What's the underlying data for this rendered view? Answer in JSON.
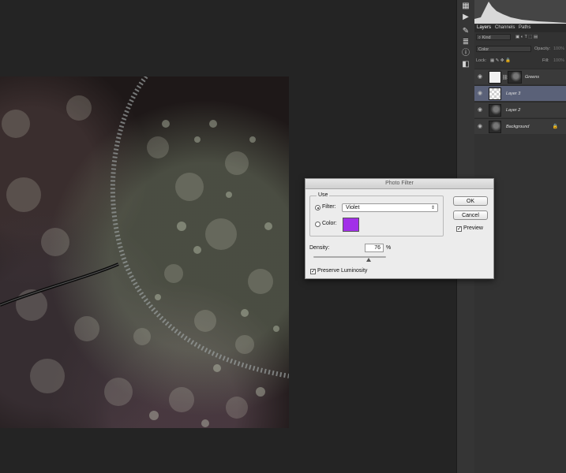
{
  "photo_filter": {
    "title": "Photo Filter",
    "use_label": "Use",
    "filter_label": "Filter:",
    "filter_value": "Violet",
    "color_label": "Color:",
    "color_swatch": "#a230e8",
    "ok_label": "OK",
    "cancel_label": "Cancel",
    "preview_label": "Preview",
    "preview_checked": true,
    "density_label": "Density:",
    "density_value": "76",
    "density_unit": "%",
    "density_fraction": 0.76,
    "preserve_label": "Preserve Luminosity",
    "preserve_checked": true,
    "selected_option": "filter"
  },
  "layers_panel": {
    "tabs": [
      "Layers",
      "Channels",
      "Paths"
    ],
    "kind_label": "Kind",
    "blend_mode": "Color",
    "opacity_label": "Opacity:",
    "opacity_value": "100%",
    "lock_label": "Lock:",
    "fill_label": "Fill:",
    "fill_value": "100%",
    "layers": [
      {
        "name": "Greens",
        "thumb": "white",
        "mask": true,
        "selected": false,
        "locked": false
      },
      {
        "name": "Layer 3",
        "thumb": "check",
        "mask": false,
        "selected": true,
        "locked": false
      },
      {
        "name": "Layer 2",
        "thumb": "dark",
        "mask": false,
        "selected": false,
        "locked": false
      },
      {
        "name": "Background",
        "thumb": "dark",
        "mask": false,
        "selected": false,
        "locked": true
      }
    ]
  },
  "icons": {
    "eye": "eye-icon",
    "lock": "lock-icon"
  }
}
